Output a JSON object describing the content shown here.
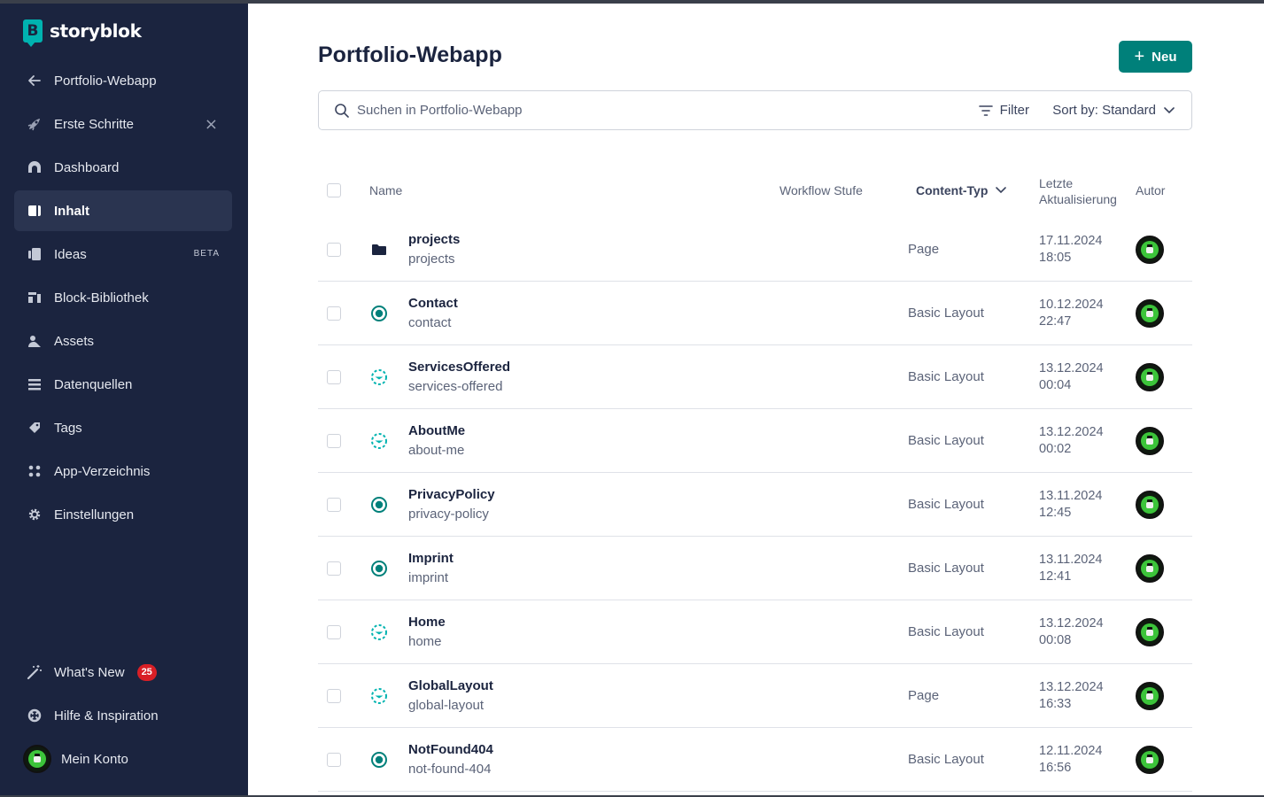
{
  "brand": {
    "name": "storyblok",
    "logo_letter": "B"
  },
  "sidebar": {
    "items": [
      {
        "label": "Portfolio-Webapp",
        "icon": "arrow-left-icon"
      },
      {
        "label": "Erste Schritte",
        "icon": "rocket-icon",
        "close": "×"
      },
      {
        "label": "Dashboard",
        "icon": "dashboard-icon"
      },
      {
        "label": "Inhalt",
        "icon": "content-icon",
        "active": true
      },
      {
        "label": "Ideas",
        "icon": "ideas-icon",
        "tag": "BETA"
      },
      {
        "label": "Block-Bibliothek",
        "icon": "blocks-icon"
      },
      {
        "label": "Assets",
        "icon": "assets-icon"
      },
      {
        "label": "Datenquellen",
        "icon": "datasources-icon"
      },
      {
        "label": "Tags",
        "icon": "tag-icon"
      },
      {
        "label": "App-Verzeichnis",
        "icon": "apps-icon"
      },
      {
        "label": "Einstellungen",
        "icon": "gear-icon"
      }
    ],
    "bottom": {
      "whats_new": {
        "label": "What's New",
        "badge": "25"
      },
      "help": {
        "label": "Hilfe & Inspiration"
      },
      "account": {
        "label": "Mein Konto"
      }
    }
  },
  "main": {
    "title": "Portfolio-Webapp",
    "new_button": "Neu",
    "search": {
      "placeholder": "Suchen in Portfolio-Webapp"
    },
    "filter_label": "Filter",
    "sort_label": "Sort by: Standard",
    "columns": {
      "name": "Name",
      "workflow": "Workflow Stufe",
      "content_type": "Content-Typ",
      "updated_line1": "Letzte",
      "updated_line2": "Aktualisierung",
      "author": "Autor"
    },
    "rows": [
      {
        "name": "projects",
        "slug": "projects",
        "type": "Page",
        "date": "17.11.2024",
        "time": "18:05",
        "status": "folder"
      },
      {
        "name": "Contact",
        "slug": "contact",
        "type": "Basic Layout",
        "date": "10.12.2024",
        "time": "22:47",
        "status": "published"
      },
      {
        "name": "ServicesOffered",
        "slug": "services-offered",
        "type": "Basic Layout",
        "date": "13.12.2024",
        "time": "00:04",
        "status": "changed"
      },
      {
        "name": "AboutMe",
        "slug": "about-me",
        "type": "Basic Layout",
        "date": "13.12.2024",
        "time": "00:02",
        "status": "changed"
      },
      {
        "name": "PrivacyPolicy",
        "slug": "privacy-policy",
        "type": "Basic Layout",
        "date": "13.11.2024",
        "time": "12:45",
        "status": "published"
      },
      {
        "name": "Imprint",
        "slug": "imprint",
        "type": "Basic Layout",
        "date": "13.11.2024",
        "time": "12:41",
        "status": "published"
      },
      {
        "name": "Home",
        "slug": "home",
        "type": "Basic Layout",
        "date": "13.12.2024",
        "time": "00:08",
        "status": "changed"
      },
      {
        "name": "GlobalLayout",
        "slug": "global-layout",
        "type": "Page",
        "date": "13.12.2024",
        "time": "16:33",
        "status": "changed"
      },
      {
        "name": "NotFound404",
        "slug": "not-found-404",
        "type": "Basic Layout",
        "date": "12.11.2024",
        "time": "16:56",
        "status": "published"
      }
    ]
  },
  "colors": {
    "sidebar_bg": "#1b243f",
    "accent": "#00807a",
    "teal": "#00b3b0",
    "badge": "#d91f26"
  }
}
